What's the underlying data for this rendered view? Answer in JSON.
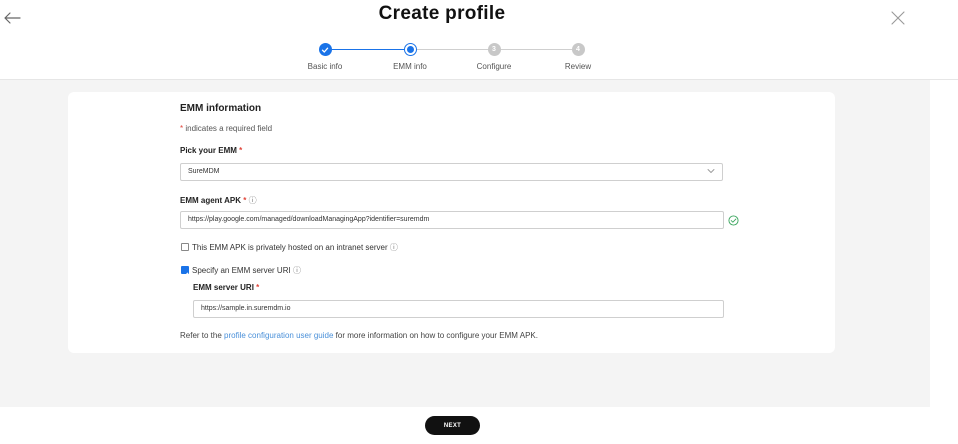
{
  "header": {
    "title": "Create profile"
  },
  "stepper": {
    "steps": [
      {
        "label": "Basic info",
        "state": "done",
        "number": "1"
      },
      {
        "label": "EMM info",
        "state": "active",
        "number": "2"
      },
      {
        "label": "Configure",
        "state": "todo",
        "number": "3"
      },
      {
        "label": "Review",
        "state": "todo",
        "number": "4"
      }
    ]
  },
  "form": {
    "section_title": "EMM information",
    "required_mark": "*",
    "required_note": " indicates a required field",
    "pick_emm": {
      "label": "Pick your EMM",
      "value": "SureMDM"
    },
    "agent_apk": {
      "label": "EMM agent APK",
      "value": "https://play.google.com/managed/downloadManagingApp?identifier=suremdm",
      "valid": true
    },
    "intranet_checkbox": {
      "label": "This EMM APK is privately hosted on an intranet server",
      "checked": false
    },
    "server_uri_checkbox": {
      "label": "Specify an EMM server URI",
      "checked": true
    },
    "server_uri": {
      "label": "EMM server URI",
      "value": "https://sample.in.suremdm.io"
    },
    "footer": {
      "prefix": "Refer to the ",
      "link": "profile configuration user guide",
      "suffix": " for more information on how to configure your EMM APK."
    }
  },
  "actions": {
    "next_label": "NEXT"
  },
  "colors": {
    "accent": "#1a73e8",
    "required": "#e0453a",
    "link": "#4a90d9",
    "valid": "#3aa55d"
  }
}
